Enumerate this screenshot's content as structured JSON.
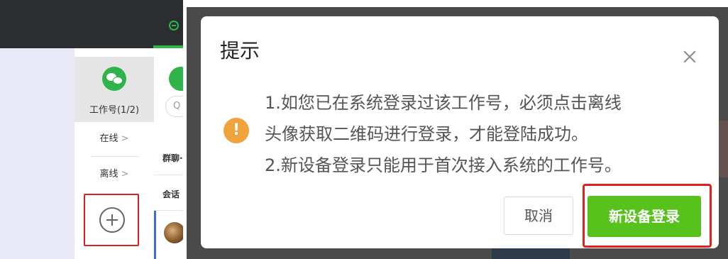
{
  "sidebar": {
    "account_label": "工作号(1/2)",
    "status_online": "在线",
    "status_offline": "离线",
    "arrow": ">"
  },
  "chat_list": {
    "group_label": "群聊·",
    "session_label": "会话"
  },
  "dialog": {
    "title": "提示",
    "message_line1": "1.如您已在系统登录过该工作号，必须点击离线",
    "message_line2": "头像获取二维码进行登录，才能登陆成功。",
    "message_line3": "2.新设备登录只能用于首次接入系统的工作号。",
    "cancel_label": "取消",
    "confirm_label": "新设备登录",
    "warning_glyph": "!"
  },
  "colors": {
    "brand_green": "#2fb34a",
    "confirm_green": "#58c21c",
    "highlight_red": "#e02020",
    "warning_orange": "#f0a33a",
    "topbar_dark": "#2b2d30"
  },
  "icons": [
    "chat-tab-icon",
    "wechat-logo-icon",
    "search-icon",
    "add-account-plus-icon",
    "close-icon",
    "warning-icon"
  ]
}
